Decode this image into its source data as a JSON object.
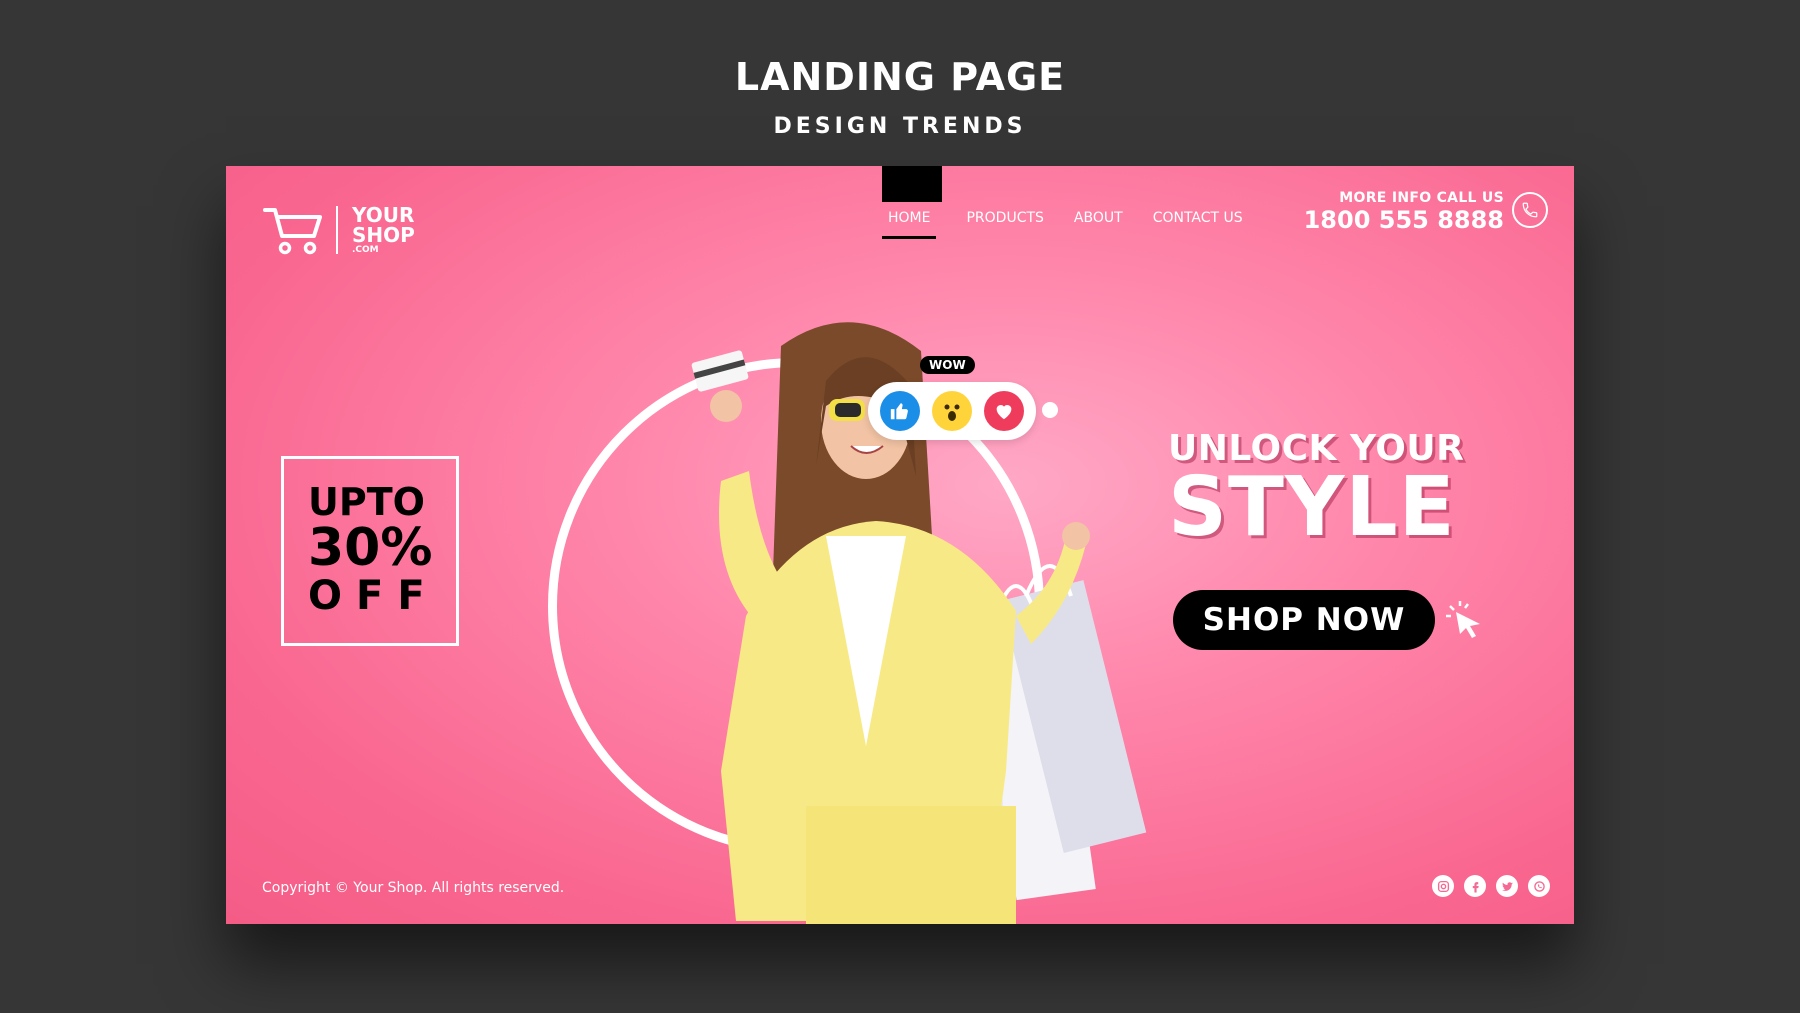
{
  "header": {
    "title": "LANDING PAGE",
    "subtitle": "DESIGN TRENDS"
  },
  "logo": {
    "line1": "YOUR",
    "line2": "SHOP",
    "line3": ".COM"
  },
  "nav": {
    "items": [
      "HOME",
      "PRODUCTS",
      "ABOUT",
      "CONTACT US"
    ],
    "active": "HOME"
  },
  "contact": {
    "label": "MORE INFO CALL US",
    "phone": "1800 555 8888"
  },
  "promo": {
    "line1": "UPTO",
    "line2": "30%",
    "line3": "OFF"
  },
  "reactions": {
    "bubble": "WOW",
    "icons": [
      "like-icon",
      "wow-face-icon",
      "heart-icon"
    ]
  },
  "hero": {
    "line1": "UNLOCK YOUR",
    "line2": "STYLE",
    "cta": "SHOP NOW"
  },
  "footer": {
    "copyright": "Copyright © Your Shop. All rights reserved.",
    "socials": [
      "instagram-icon",
      "facebook-icon",
      "twitter-icon",
      "whatsapp-icon"
    ]
  },
  "colors": {
    "page_bg": "#363636",
    "accent_pink": "#f96790",
    "button_bg": "#000000"
  }
}
